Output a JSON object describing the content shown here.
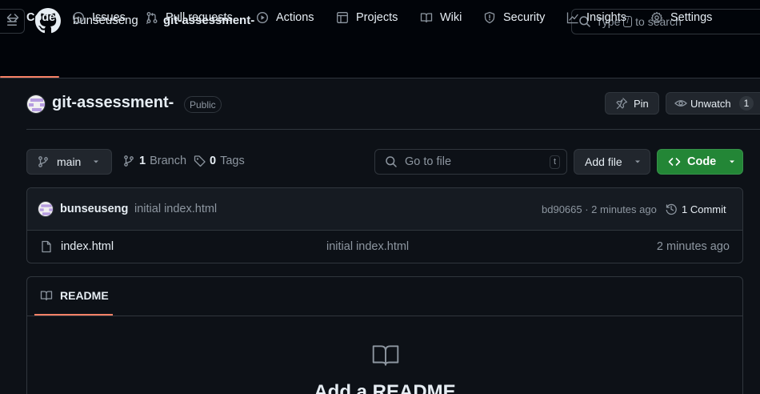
{
  "header": {
    "owner": "bunseuseng",
    "separator": "/",
    "repo": "git-assessment-",
    "search": {
      "prefix": "Type",
      "key": "/",
      "suffix": "to search"
    }
  },
  "nav": {
    "tabs": [
      {
        "label": "Code",
        "icon": "code-icon",
        "active": true
      },
      {
        "label": "Issues",
        "icon": "issue-icon"
      },
      {
        "label": "Pull requests",
        "icon": "pull-request-icon"
      },
      {
        "label": "Actions",
        "icon": "play-icon"
      },
      {
        "label": "Projects",
        "icon": "table-icon"
      },
      {
        "label": "Wiki",
        "icon": "book-icon"
      },
      {
        "label": "Security",
        "icon": "shield-icon"
      },
      {
        "label": "Insights",
        "icon": "graph-icon"
      },
      {
        "label": "Settings",
        "icon": "gear-icon"
      }
    ]
  },
  "repo": {
    "title": "git-assessment-",
    "visibility": "Public",
    "pin_label": "Pin",
    "watch_label": "Unwatch",
    "watch_count": "1"
  },
  "toolbar": {
    "branch": "main",
    "branch_count": "1",
    "branch_label": "Branch",
    "tag_count": "0",
    "tag_label": "Tags",
    "goto_placeholder": "Go to file",
    "goto_key": "t",
    "add_file_label": "Add file",
    "code_label": "Code"
  },
  "commit": {
    "author": "bunseuseng",
    "message": "initial index.html",
    "hash_time": "bd90665 · 2 minutes ago",
    "commit_count_label": "1 Commit"
  },
  "files": [
    {
      "name": "index.html",
      "message": "initial index.html",
      "time": "2 minutes ago"
    }
  ],
  "readme": {
    "tab_label": "README",
    "heading": "Add a README"
  },
  "colors": {
    "bg": "#0d1117",
    "header_bg": "#010409",
    "border": "#30363d",
    "accent": "#f78166",
    "code_button": "#238636",
    "muted": "#8d96a0"
  }
}
